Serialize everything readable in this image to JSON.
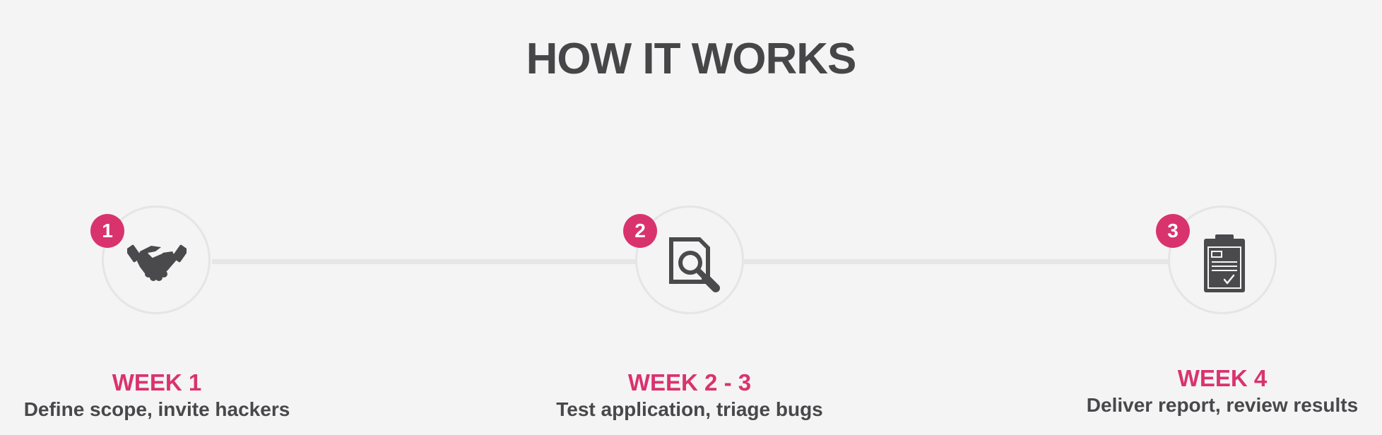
{
  "page_title": "HOW IT WORKS",
  "accent_color": "#d9336e",
  "steps": [
    {
      "number": "1",
      "icon": "handshake-icon",
      "week": "WEEK 1",
      "description": "Define scope, invite hackers"
    },
    {
      "number": "2",
      "icon": "document-search-icon",
      "week": "WEEK 2 - 3",
      "description": "Test application, triage bugs"
    },
    {
      "number": "3",
      "icon": "clipboard-report-icon",
      "week": "WEEK 4",
      "description": "Deliver report, review results"
    }
  ]
}
